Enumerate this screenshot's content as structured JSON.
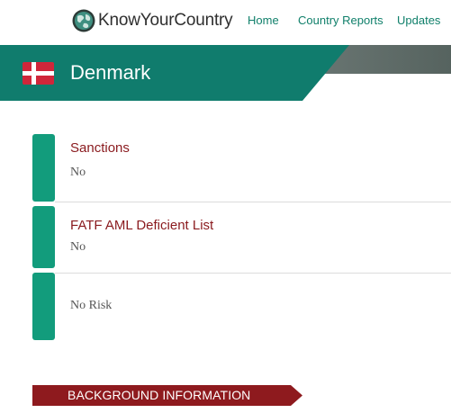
{
  "header": {
    "brand": "KnowYourCountry",
    "nav": {
      "home": "Home",
      "country_reports": "Country Reports",
      "updates": "Updates"
    }
  },
  "banner": {
    "country": "Denmark"
  },
  "risk_items": [
    {
      "title": "Sanctions",
      "value": "No"
    },
    {
      "title": "FATF AML Deficient List",
      "value": "No"
    },
    {
      "title": "",
      "value": "No Risk"
    }
  ],
  "section": {
    "background_label": "BACKGROUND INFORMATION"
  },
  "colors": {
    "brand_green": "#107c6d",
    "row_bar": "#129c7c",
    "accent_red": "#8e1a1e",
    "nav_link": "#0f7f6a",
    "flag_red": "#d0263a"
  },
  "icons": {
    "logo": "globe-icon",
    "flag": "denmark-flag-icon"
  }
}
